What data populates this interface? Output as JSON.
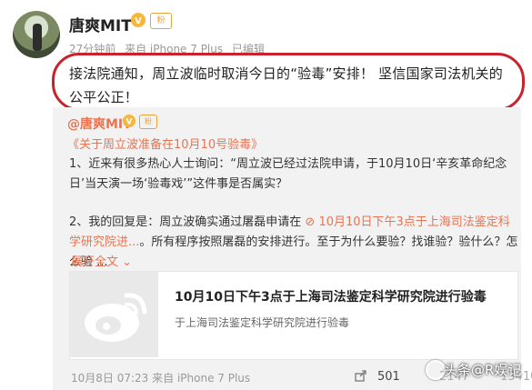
{
  "post": {
    "author": "唐爽MIT",
    "verified_badge": "V",
    "fan_badge": "粉",
    "meta": {
      "time": "27分钟前",
      "source": "来自 iPhone 7 Plus",
      "edited": "已编辑"
    },
    "text": "接法院通知，周立波临时取消今日的“验毒”安排！ 坚信国家司法机关的公平公正！"
  },
  "repost": {
    "author": "@唐爽MIT",
    "title": "《关于周立波准备在10月10号验毒》",
    "para1": "1、近来有很多热心人士询问：“周立波已经过法院申请，于10月10日‘辛亥革命纪念日’当天演一场‘验毒戏’”这件事是否属实？",
    "para2_prefix": "2、我的回复是：周立波确实通过屠磊申请在 ",
    "para2_link": "10月10日下午3点于上海司法鉴定科学研究院进...",
    "para2_suffix": "。所有程序按照屠磊的安排进行。至于为什么要验？找谁验？验什么？怎么验 ...",
    "expand_label": "展开全文",
    "card": {
      "title": "10月10日下午3点于上海司法鉴定科学研究院进行验毒",
      "subtitle": "于上海司法鉴定科学研究院进行验毒"
    },
    "footer": {
      "time": "10月8日 07:23",
      "source": "来自 iPhone 7 Plus",
      "share_count": "501",
      "comment_count": "2147",
      "like_count": "13410"
    }
  },
  "watermark": "头条@R娱记",
  "colors": {
    "accent": "#eb7350",
    "highlight": "#c8232c",
    "repost_bg": "#f2f2f2"
  }
}
